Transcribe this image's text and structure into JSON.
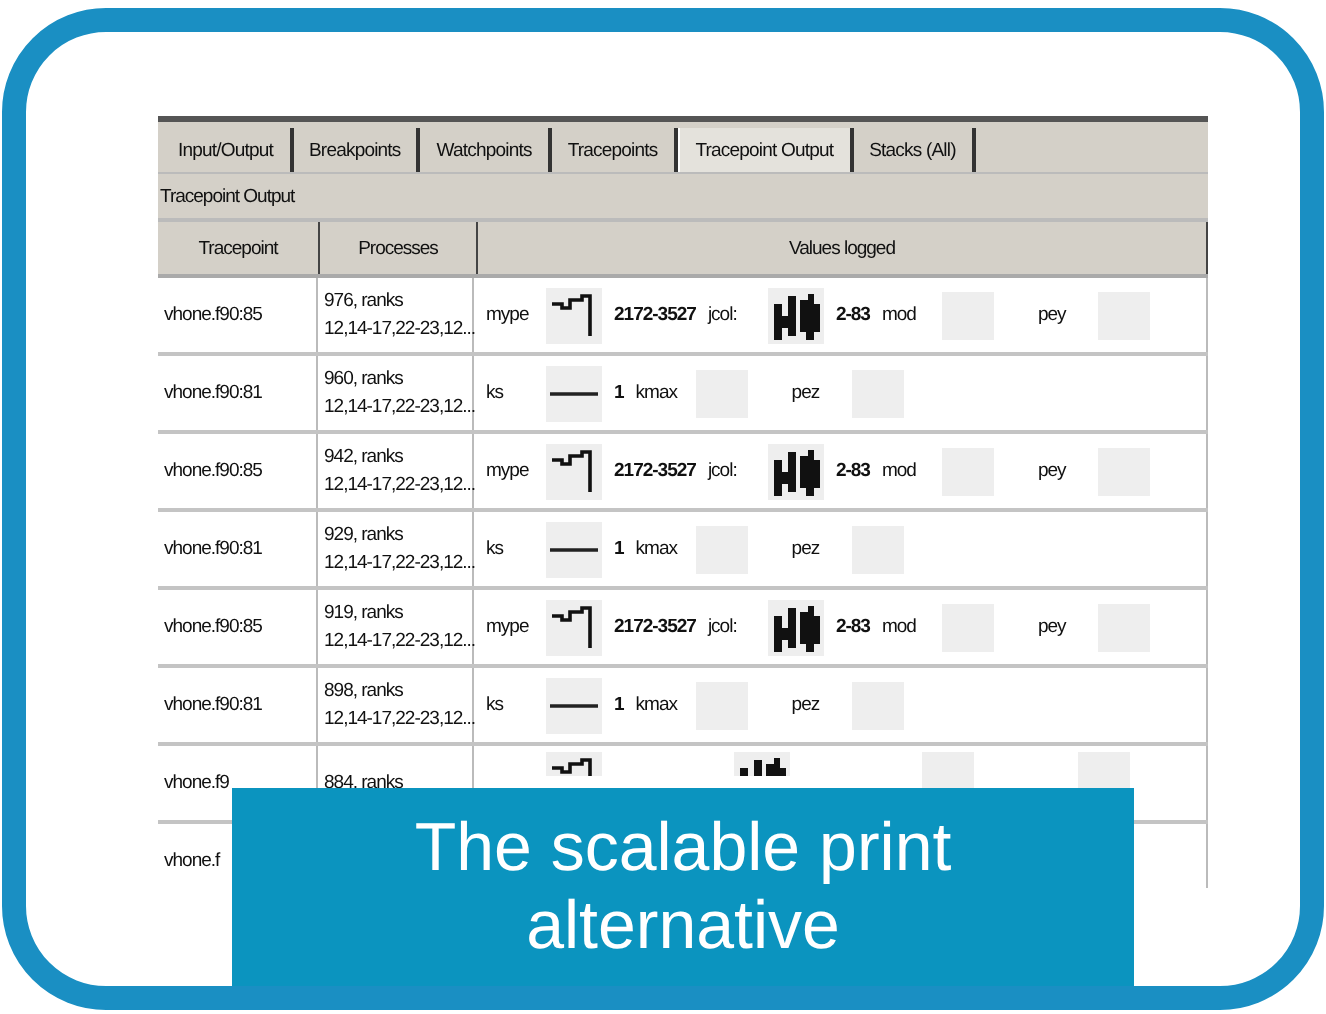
{
  "tabs": [
    {
      "label": "Input/Output",
      "selected": false
    },
    {
      "label": "Breakpoints",
      "selected": false
    },
    {
      "label": "Watchpoints",
      "selected": false
    },
    {
      "label": "Tracepoints",
      "selected": false
    },
    {
      "label": "Tracepoint Output",
      "selected": true
    },
    {
      "label": "Stacks (All)",
      "selected": false
    }
  ],
  "panel_title": "Tracepoint Output",
  "table": {
    "columns": [
      "Tracepoint",
      "Processes",
      "Values logged"
    ],
    "rows": [
      {
        "tracepoint": "vhone.f90:85",
        "processes": [
          "976, ranks",
          "12,14-17,22-23,12..."
        ],
        "values": [
          {
            "kind": "label",
            "text": "mype"
          },
          {
            "kind": "spark"
          },
          {
            "kind": "bold",
            "text": "2172-3527"
          },
          {
            "kind": "label",
            "text": "jcol:"
          },
          {
            "kind": "blocks"
          },
          {
            "kind": "bold",
            "text": "2-83"
          },
          {
            "kind": "label",
            "text": "mod"
          },
          {
            "kind": "box"
          },
          {
            "kind": "label",
            "text": "pey"
          },
          {
            "kind": "box"
          }
        ]
      },
      {
        "tracepoint": "vhone.f90:81",
        "processes": [
          "960, ranks",
          "12,14-17,22-23,12..."
        ],
        "values": [
          {
            "kind": "label",
            "text": "ks"
          },
          {
            "kind": "line"
          },
          {
            "kind": "bold",
            "text": "1"
          },
          {
            "kind": "label",
            "text": "kmax"
          },
          {
            "kind": "box"
          },
          {
            "kind": "label",
            "text": "pez"
          },
          {
            "kind": "box"
          }
        ]
      },
      {
        "tracepoint": "vhone.f90:85",
        "processes": [
          "942, ranks",
          "12,14-17,22-23,12..."
        ],
        "values": [
          {
            "kind": "label",
            "text": "mype"
          },
          {
            "kind": "spark"
          },
          {
            "kind": "bold",
            "text": "2172-3527"
          },
          {
            "kind": "label",
            "text": "jcol:"
          },
          {
            "kind": "blocks"
          },
          {
            "kind": "bold",
            "text": "2-83"
          },
          {
            "kind": "label",
            "text": "mod"
          },
          {
            "kind": "box"
          },
          {
            "kind": "label",
            "text": "pey"
          },
          {
            "kind": "box"
          }
        ]
      },
      {
        "tracepoint": "vhone.f90:81",
        "processes": [
          "929, ranks",
          "12,14-17,22-23,12..."
        ],
        "values": [
          {
            "kind": "label",
            "text": "ks"
          },
          {
            "kind": "line"
          },
          {
            "kind": "bold",
            "text": "1"
          },
          {
            "kind": "label",
            "text": "kmax"
          },
          {
            "kind": "box"
          },
          {
            "kind": "label",
            "text": "pez"
          },
          {
            "kind": "box"
          }
        ]
      },
      {
        "tracepoint": "vhone.f90:85",
        "processes": [
          "919, ranks",
          "12,14-17,22-23,12..."
        ],
        "values": [
          {
            "kind": "label",
            "text": "mype"
          },
          {
            "kind": "spark"
          },
          {
            "kind": "bold",
            "text": "2172-3527"
          },
          {
            "kind": "label",
            "text": "jcol:"
          },
          {
            "kind": "blocks"
          },
          {
            "kind": "bold",
            "text": "2-83"
          },
          {
            "kind": "label",
            "text": "mod"
          },
          {
            "kind": "box"
          },
          {
            "kind": "label",
            "text": "pey"
          },
          {
            "kind": "box"
          }
        ]
      },
      {
        "tracepoint": "vhone.f90:81",
        "processes": [
          "898, ranks",
          "12,14-17,22-23,12..."
        ],
        "values": [
          {
            "kind": "label",
            "text": "ks"
          },
          {
            "kind": "line"
          },
          {
            "kind": "bold",
            "text": "1"
          },
          {
            "kind": "label",
            "text": "kmax"
          },
          {
            "kind": "box"
          },
          {
            "kind": "label",
            "text": "pez"
          },
          {
            "kind": "box"
          }
        ]
      },
      {
        "tracepoint": "vhone.f9",
        "processes": [
          "884, ranks"
        ],
        "values": [
          {
            "kind": "blank"
          },
          {
            "kind": "spark_cut"
          },
          {
            "kind": "blank"
          },
          {
            "kind": "blank"
          },
          {
            "kind": "blocks_cut"
          },
          {
            "kind": "blank"
          },
          {
            "kind": "blank"
          },
          {
            "kind": "box_cut"
          },
          {
            "kind": "blank"
          },
          {
            "kind": "box_cut"
          }
        ]
      },
      {
        "tracepoint": "vhone.f",
        "processes": [],
        "values": []
      }
    ]
  },
  "caption": [
    "The scalable print",
    "alternative"
  ]
}
